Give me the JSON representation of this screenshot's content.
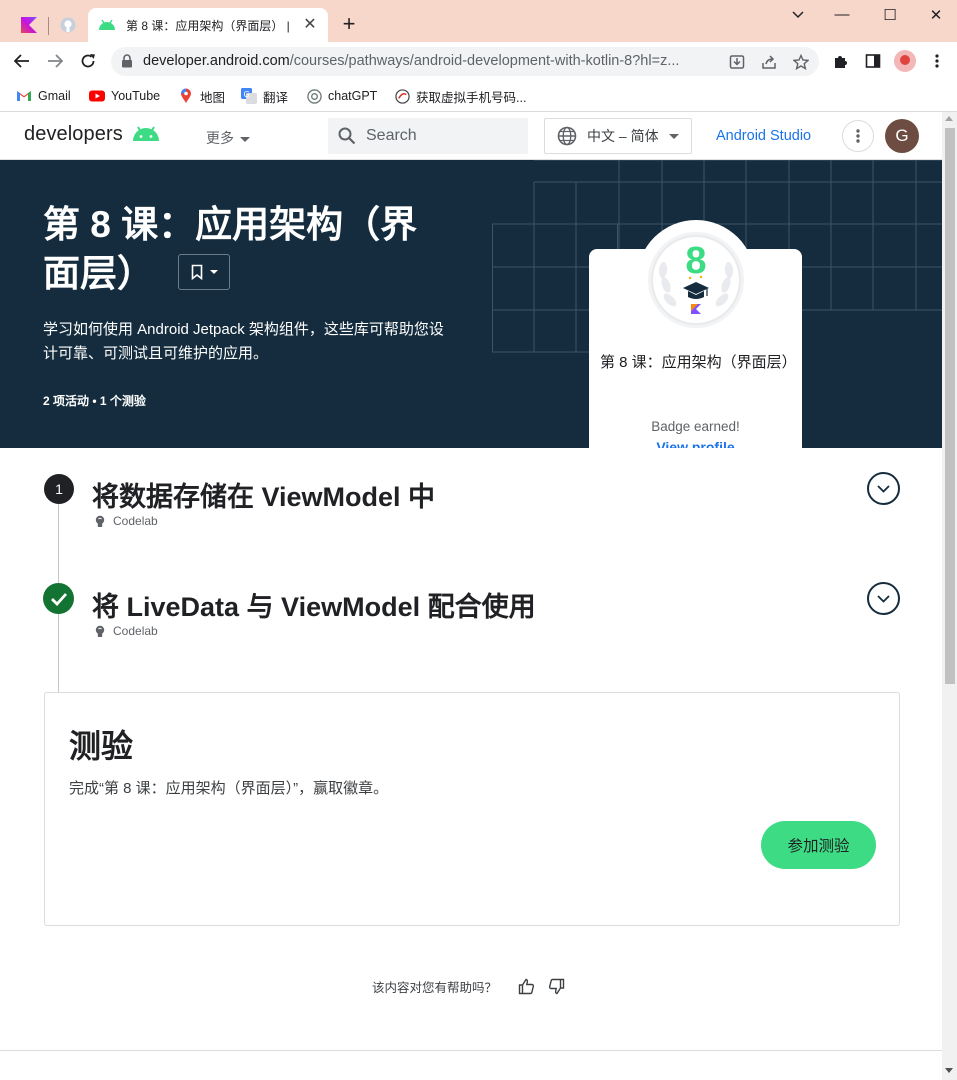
{
  "browser": {
    "tab": {
      "title": "第 8 课：应用架构（界面层） |"
    },
    "address": {
      "url_host": "developer.android.com",
      "url_path": "/courses/pathways/android-development-with-kotlin-8?hl=z..."
    },
    "bookmarks": [
      {
        "label": "Gmail",
        "icon": "gmail-icon"
      },
      {
        "label": "YouTube",
        "icon": "youtube-icon"
      },
      {
        "label": "地图",
        "icon": "maps-icon"
      },
      {
        "label": "翻译",
        "icon": "translate-icon"
      },
      {
        "label": "chatGPT",
        "icon": "chatgpt-icon"
      },
      {
        "label": "获取虚拟手机号码...",
        "icon": "site-icon"
      }
    ],
    "window_controls": {
      "minimize": "—",
      "maximize": "☐",
      "close": "✕"
    }
  },
  "site": {
    "logo": "developers",
    "more_menu": "更多",
    "search_placeholder": "Search",
    "language": "中文 – 简体",
    "studio_link": "Android Studio",
    "user_initial": "G",
    "brand_color": "#3ddc84",
    "link_color": "#1a73e8"
  },
  "hero": {
    "title_line1": "第 8 课：应用架构（界",
    "title_line2": "面层）",
    "description": "学习如何使用 Android Jetpack 架构组件，这些库可帮助您设计可靠、可测试且可维护的应用。",
    "meta": "2 项活动 • 1 个测验",
    "background": "#142c3d"
  },
  "badge": {
    "number": "8",
    "title": "第 8 课：应用架构（界面层）",
    "earned_text": "Badge earned!",
    "view_profile": "View profile"
  },
  "steps": [
    {
      "marker": "1",
      "title": "将数据存储在 ViewModel 中",
      "type": "Codelab",
      "status": "numbered"
    },
    {
      "marker": "",
      "title": "将 LiveData 与 ViewModel 配合使用",
      "type": "Codelab",
      "status": "completed"
    }
  ],
  "quiz": {
    "title": "测验",
    "description": "完成“第 8 课：应用架构（界面层）”，赢取徽章。",
    "button": "参加测验"
  },
  "feedback": {
    "question": "该内容对您有帮助吗？"
  }
}
